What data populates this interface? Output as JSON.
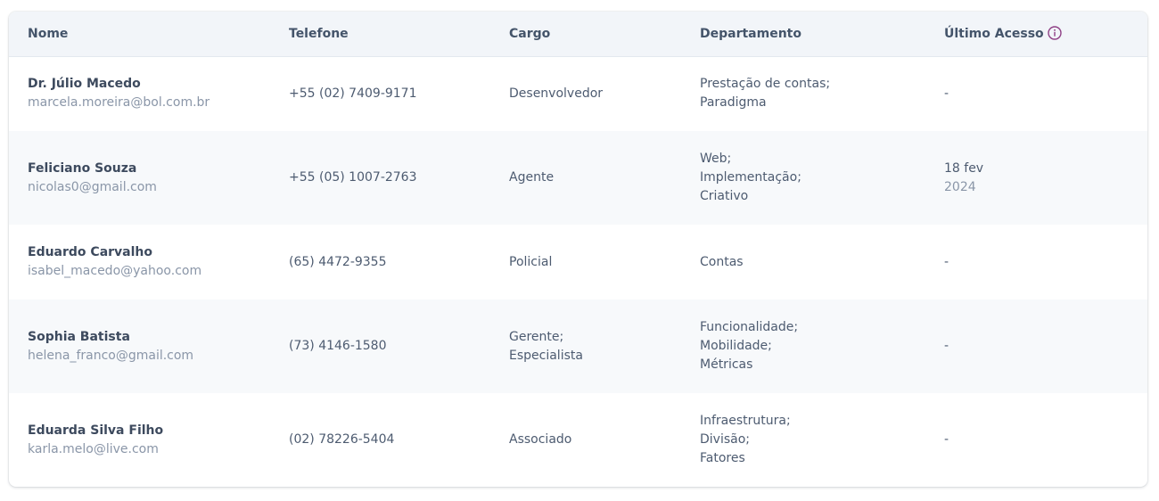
{
  "table": {
    "headers": {
      "nome": "Nome",
      "telefone": "Telefone",
      "cargo": "Cargo",
      "departamento": "Departamento",
      "ultimo_acesso": "Último Acesso"
    },
    "info_icon": "info-circle-icon",
    "accent_color": "#8e3f85",
    "rows": [
      {
        "name": "Dr. Júlio Macedo",
        "email": "marcela.moreira@bol.com.br",
        "phone": "+55 (02) 7409-9171",
        "cargo": [
          "Desenvolvedor"
        ],
        "departamento": [
          "Prestação de contas;",
          "Paradigma"
        ],
        "acesso": [
          "-"
        ]
      },
      {
        "name": "Feliciano Souza",
        "email": "nicolas0@gmail.com",
        "phone": "+55 (05) 1007-2763",
        "cargo": [
          "Agente"
        ],
        "departamento": [
          "Web;",
          "Implementação;",
          "Criativo"
        ],
        "acesso": [
          "18 fev",
          "2024"
        ]
      },
      {
        "name": "Eduardo Carvalho",
        "email": "isabel_macedo@yahoo.com",
        "phone": "(65) 4472-9355",
        "cargo": [
          "Policial"
        ],
        "departamento": [
          "Contas"
        ],
        "acesso": [
          "-"
        ]
      },
      {
        "name": "Sophia Batista",
        "email": "helena_franco@gmail.com",
        "phone": "(73) 4146-1580",
        "cargo": [
          "Gerente;",
          "Especialista"
        ],
        "departamento": [
          "Funcionalidade;",
          "Mobilidade;",
          "Métricas"
        ],
        "acesso": [
          "-"
        ]
      },
      {
        "name": "Eduarda Silva Filho",
        "email": "karla.melo@live.com",
        "phone": "(02) 78226-5404",
        "cargo": [
          "Associado"
        ],
        "departamento": [
          "Infraestrutura;",
          "Divisão;",
          "Fatores"
        ],
        "acesso": [
          "-"
        ]
      }
    ]
  }
}
